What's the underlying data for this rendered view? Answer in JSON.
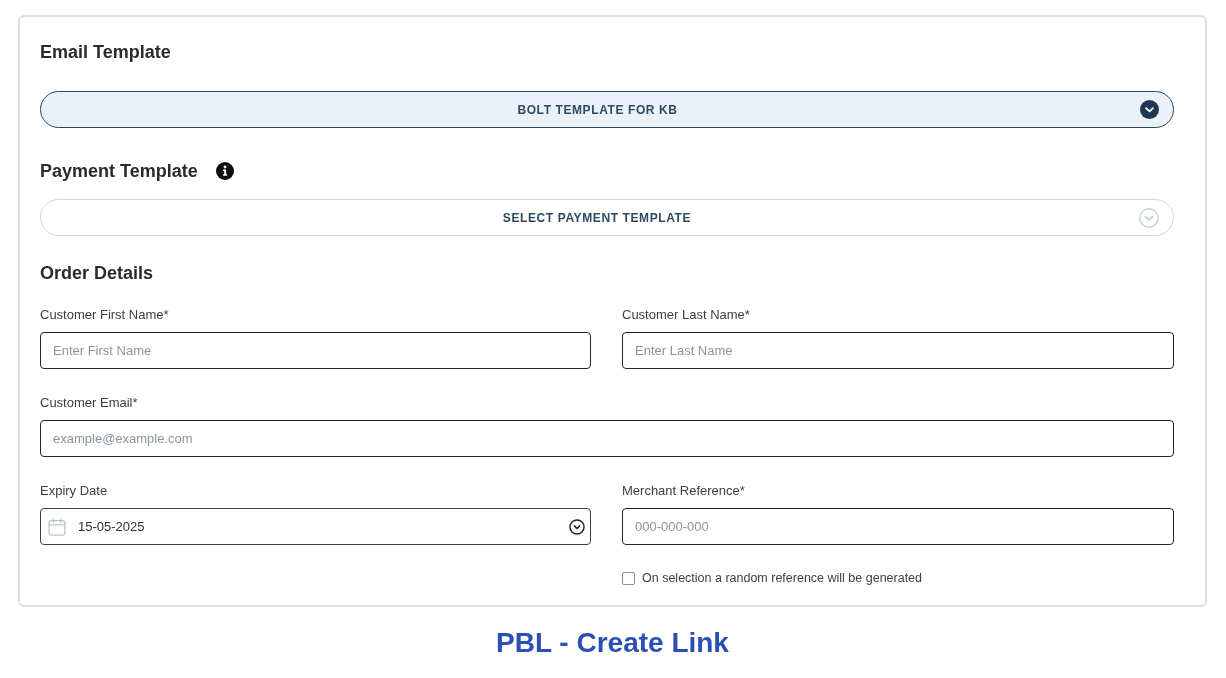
{
  "email_template": {
    "heading": "Email Template",
    "dropdown": {
      "value": "BOLT TEMPLATE FOR KB"
    }
  },
  "payment_template": {
    "heading": "Payment Template",
    "dropdown": {
      "placeholder": "SELECT PAYMENT TEMPLATE"
    }
  },
  "order_details": {
    "heading": "Order Details",
    "rows": [
      {
        "fields": [
          {
            "kind": "text",
            "label": "Customer First Name*",
            "placeholder": "Enter First Name"
          },
          {
            "kind": "text",
            "label": "Customer Last Name*",
            "placeholder": "Enter Last Name"
          }
        ]
      },
      {
        "fields": [
          {
            "kind": "text",
            "label": "Customer Email*",
            "placeholder": "example@example.com"
          }
        ]
      },
      {
        "fields": [
          {
            "kind": "date",
            "label": "Expiry Date",
            "value": "15-05-2025"
          },
          {
            "kind": "text",
            "label": "Merchant Reference*",
            "placeholder": "000-000-000",
            "checkbox": {
              "label": "On selection a random reference will be generated",
              "checked": false
            }
          }
        ]
      }
    ]
  },
  "caption": "PBL - Create Link"
}
